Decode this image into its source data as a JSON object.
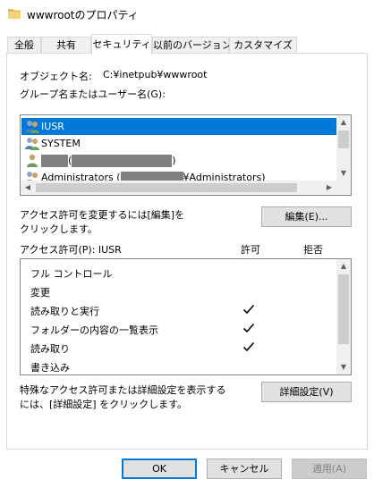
{
  "window": {
    "title": "wwwrootのプロパティ"
  },
  "tabs": [
    {
      "label": "全般"
    },
    {
      "label": "共有"
    },
    {
      "label": "セキュリティ"
    },
    {
      "label": "以前のバージョン"
    },
    {
      "label": "カスタマイズ"
    }
  ],
  "security": {
    "object_name_label": "オブジェクト名:",
    "object_name_value": "C:¥inetpub¥wwwroot",
    "group_label": "グループ名またはユーザー名(G):",
    "principals": [
      {
        "name": "IUSR",
        "selected": true,
        "icon": "user-group-icon"
      },
      {
        "name": "SYSTEM",
        "selected": false,
        "icon": "user-group-icon"
      },
      {
        "name": "(",
        "suffix": ")",
        "selected": false,
        "icon": "single-user-icon"
      },
      {
        "name": "Administrators (",
        "suffix": "¥Administrators)",
        "selected": false,
        "icon": "user-group-icon"
      }
    ],
    "edit_hint_line1": "アクセス許可を変更するには[編集]を",
    "edit_hint_line2": "クリックします。",
    "edit_button": "編集(E)...",
    "permissions_for_label": "アクセス許可(P): IUSR",
    "allow_header": "許可",
    "deny_header": "拒否",
    "permissions": [
      {
        "name": "フル コントロール",
        "allow": false,
        "deny": false
      },
      {
        "name": "変更",
        "allow": false,
        "deny": false
      },
      {
        "name": "読み取りと実行",
        "allow": true,
        "deny": false
      },
      {
        "name": "フォルダーの内容の一覧表示",
        "allow": true,
        "deny": false
      },
      {
        "name": "読み取り",
        "allow": true,
        "deny": false
      },
      {
        "name": "書き込み",
        "allow": false,
        "deny": false
      }
    ],
    "advanced_hint_line1": "特殊なアクセス許可または詳細設定を表示する",
    "advanced_hint_line2": "には、[詳細設定] をクリックします。",
    "advanced_button": "詳細設定(V)"
  },
  "footer": {
    "ok_button": "OK",
    "cancel_button": "キャンセル",
    "apply_button": "適用(A)"
  },
  "colors": {
    "selection": "#0078d7",
    "folder": "#e8b84a"
  }
}
